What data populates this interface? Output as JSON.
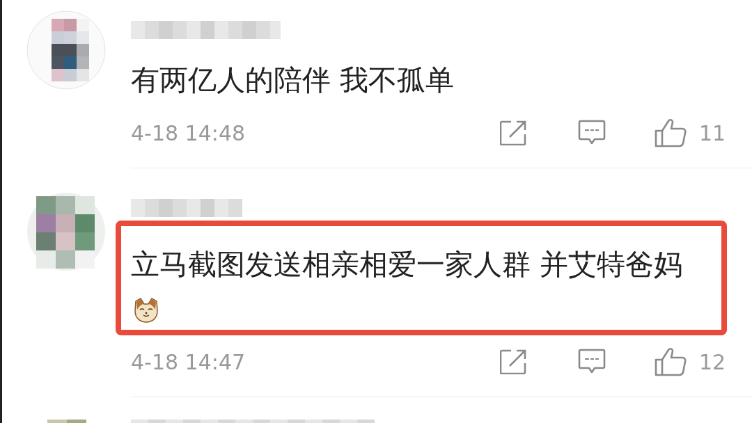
{
  "comments": [
    {
      "text": "有两亿人的陪伴 我不孤单",
      "highlighted": false,
      "cat_emoji": false,
      "time": "4-18 14:48",
      "likes": "11"
    },
    {
      "text": "立马截图发送相亲相爱一家人群 并艾特爸妈",
      "highlighted": true,
      "cat_emoji": true,
      "time": "4-18 14:47",
      "likes": "12"
    }
  ]
}
